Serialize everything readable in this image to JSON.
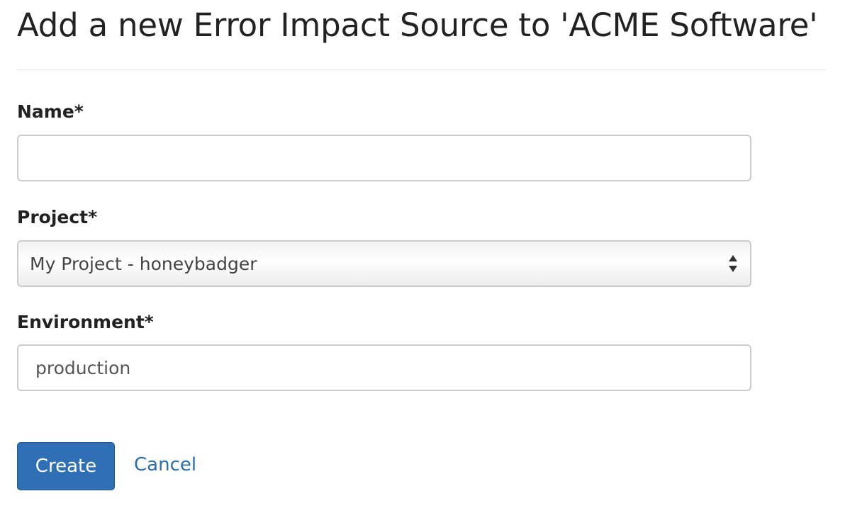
{
  "page": {
    "title": "Add a new Error Impact Source to 'ACME Software'"
  },
  "form": {
    "name": {
      "label": "Name*",
      "value": ""
    },
    "project": {
      "label": "Project*",
      "selected": "My Project - honeybadger"
    },
    "environment": {
      "label": "Environment*",
      "value": "production"
    }
  },
  "actions": {
    "create_label": "Create",
    "cancel_label": "Cancel"
  },
  "colors": {
    "primary_button": "#2f6fb5",
    "link": "#2a6db0",
    "input_border": "#cccccc"
  },
  "icons": {
    "select": "select-arrows-icon"
  }
}
